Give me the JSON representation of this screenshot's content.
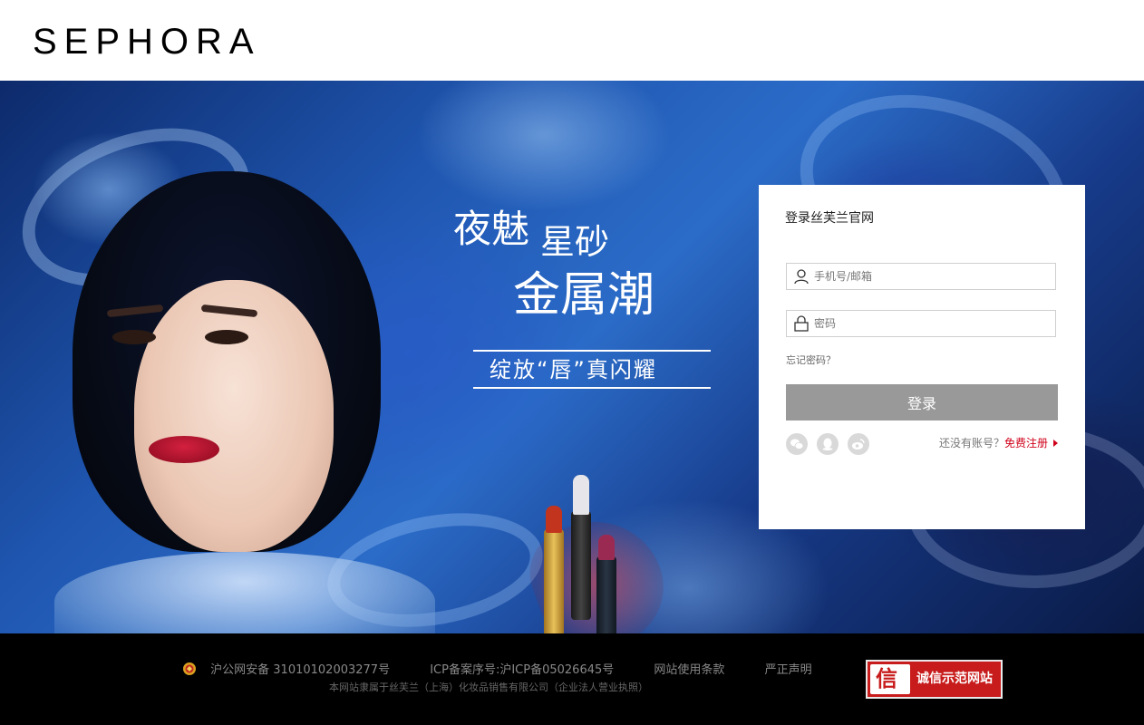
{
  "header": {
    "brand": "SEPHORA"
  },
  "hero": {
    "line1a": "夜魅",
    "line1b": "星砂",
    "line2": "金属潮",
    "line3": "绽放“唇”真闪耀"
  },
  "login": {
    "title": "登录丝芙兰官网",
    "phone_placeholder": "手机号/邮箱",
    "password_placeholder": "密码",
    "forgot": "忘记密码？",
    "submit": "登录",
    "no_account": "还没有账号？",
    "register": "免费注册",
    "social": [
      "wechat-icon",
      "qq-icon",
      "weibo-icon"
    ]
  },
  "footer": {
    "police_record": "沪公网安备 31010102003277号",
    "icp": "ICP备案序号:沪ICP备05026645号",
    "terms": "网站使用条款",
    "statement": "严正声明",
    "company": "本网站隶属于丝芙兰（上海）化妆品销售有限公司（企业法人营业执照）",
    "trust_mark": "信",
    "trust_badge": "诚信示范网站"
  },
  "colors": {
    "accent": "#d0021b",
    "button": "#999999",
    "footer_bg": "#000000",
    "trust_bg": "#c81c1c"
  }
}
